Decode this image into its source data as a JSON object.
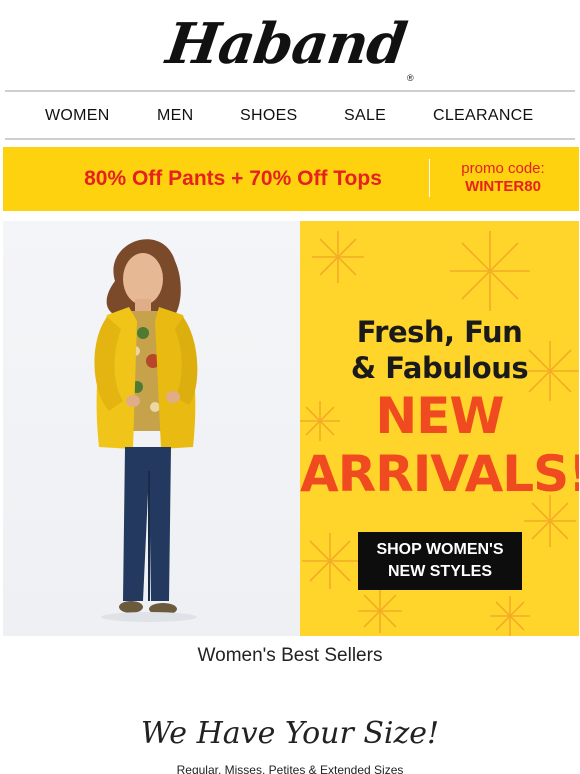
{
  "brand": {
    "logo": "Haband",
    "registered": "®"
  },
  "nav": {
    "items": [
      "WOMEN",
      "MEN",
      "SHOES",
      "SALE",
      "CLEARANCE"
    ]
  },
  "promo": {
    "headline": "80% Off Pants + 70% Off Tops",
    "code_label": "promo code:",
    "code": "WINTER80"
  },
  "hero": {
    "line1": "Fresh, Fun",
    "line2": "& Fabulous",
    "line3": "NEW",
    "line4": "ARRIVALS!",
    "cta_line1": "SHOP WOMEN'S",
    "cta_line2": "NEW STYLES"
  },
  "sections": {
    "best_sellers": "Women's Best Sellers",
    "size_title": "We Have Your Size!",
    "size_subtitle": "Regular, Misses, Petites & Extended Sizes"
  },
  "colors": {
    "promo_bg": "#ffd20f",
    "promo_text": "#e4221f",
    "banner_bg": "#ffd42b",
    "banner_accent": "#f04b20",
    "cta_bg": "#0d0d0d",
    "cardigan": "#f0c419",
    "jeans": "#24395f"
  }
}
